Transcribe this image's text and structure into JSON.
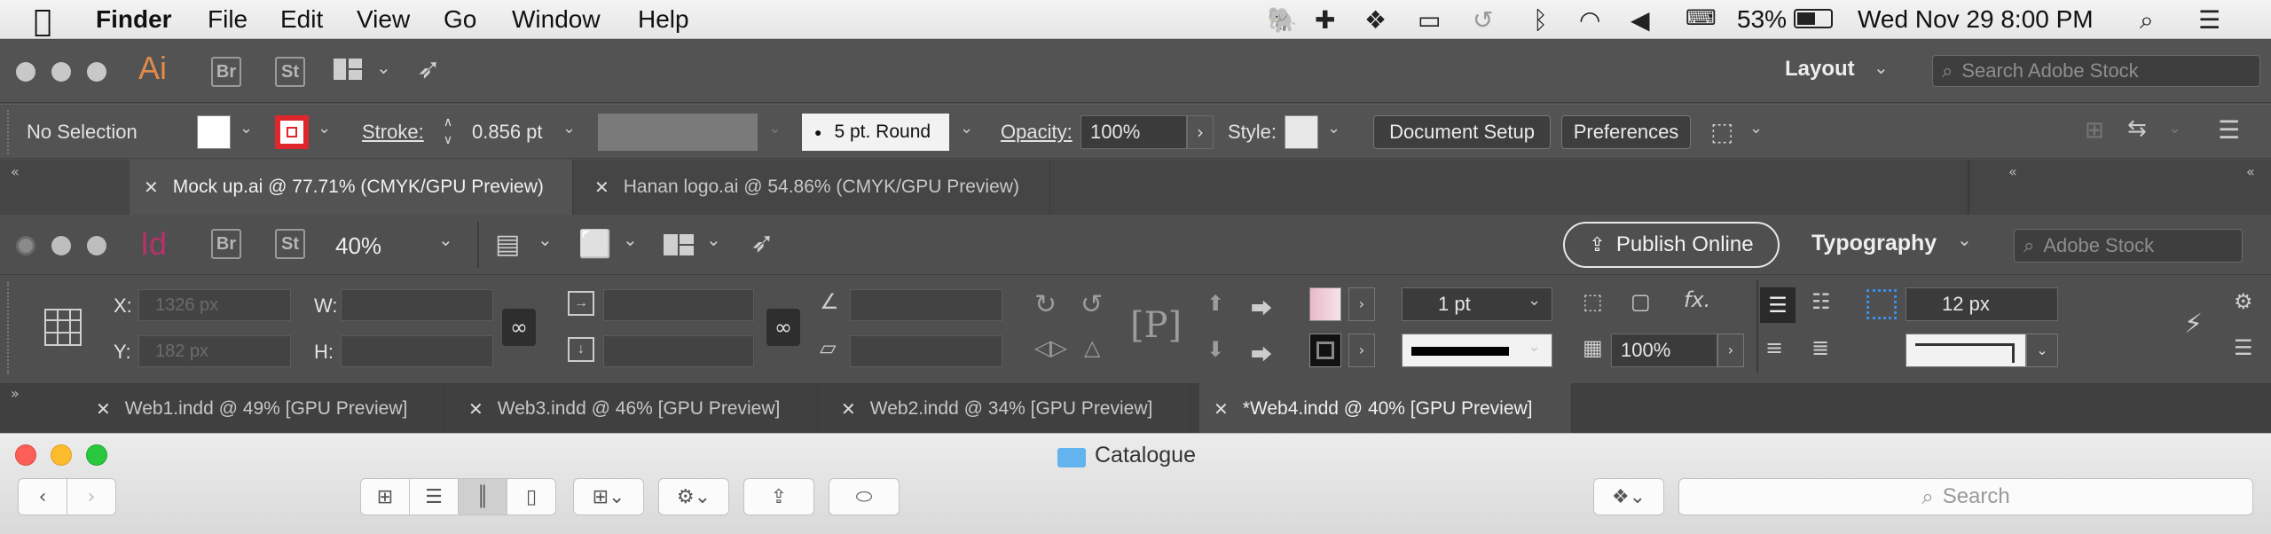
{
  "menubar": {
    "app": "Finder",
    "menus": [
      "File",
      "Edit",
      "View",
      "Go",
      "Window",
      "Help"
    ],
    "battery": "53%",
    "datetime": "Wed Nov 29  8:00 PM"
  },
  "illustrator": {
    "logo": "Ai",
    "bridge": "Br",
    "stock": "St",
    "workspace": "Layout",
    "search_placeholder": "Search Adobe Stock",
    "control": {
      "selection": "No Selection",
      "stroke_label": "Stroke:",
      "stroke_value": "0.856 pt",
      "brush": "5 pt. Round",
      "opacity_label": "Opacity:",
      "opacity_value": "100%",
      "style_label": "Style:",
      "document_setup": "Document Setup",
      "preferences": "Preferences"
    },
    "tabs": [
      {
        "label": "Mock up.ai @ 77.71% (CMYK/GPU Preview)"
      },
      {
        "label": "Hanan logo.ai @ 54.86% (CMYK/GPU Preview)"
      }
    ],
    "colors": {
      "fill": "#ffffff",
      "stroke": "#e0262d"
    }
  },
  "indesign": {
    "logo": "Id",
    "bridge": "Br",
    "stock": "St",
    "zoom": "40%",
    "publish": "Publish Online",
    "workspace": "Typography",
    "search_placeholder": "Adobe Stock",
    "control": {
      "x_label": "X:",
      "y_label": "Y:",
      "w_label": "W:",
      "h_label": "H:",
      "x_value": "1326 px",
      "y_value": "182 px",
      "stroke_weight": "1 pt",
      "opacity": "100%",
      "gutter": "12 px"
    },
    "tabs": [
      {
        "label": "Web1.indd @ 49% [GPU Preview]"
      },
      {
        "label": "Web3.indd @ 46% [GPU Preview]"
      },
      {
        "label": "Web2.indd @ 34% [GPU Preview]"
      },
      {
        "label": "*Web4.indd @ 40% [GPU Preview]"
      }
    ]
  },
  "finder": {
    "title": "Catalogue",
    "search_placeholder": "Search"
  }
}
